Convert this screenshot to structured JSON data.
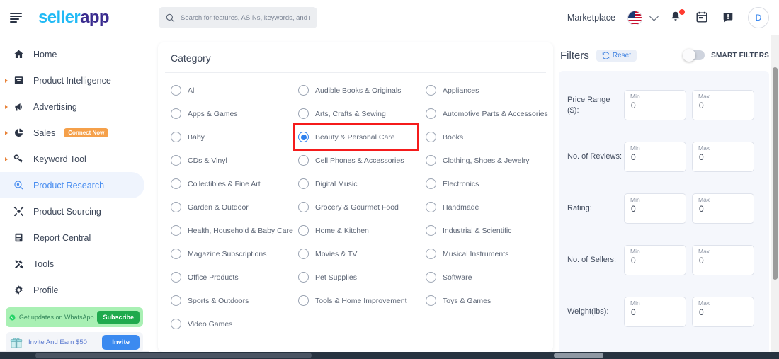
{
  "brand": {
    "name_part1": "seller",
    "name_part2": "app"
  },
  "topbar": {
    "menu_icon": "hamburger-icon",
    "search": {
      "placeholder": "Search for features, ASINs, keywords, and more",
      "value": ""
    },
    "marketplace_label": "Marketplace",
    "flag": "us-flag-icon",
    "notifications_icon": "bell-icon",
    "calendar_icon": "calendar-icon",
    "announcement_icon": "announcement-icon",
    "avatar_initial": "D"
  },
  "sidebar": {
    "items": [
      {
        "label": "Home",
        "icon": "home-icon",
        "expandable": false,
        "active": false
      },
      {
        "label": "Product Intelligence",
        "icon": "archive-icon",
        "expandable": true,
        "active": false
      },
      {
        "label": "Advertising",
        "icon": "megaphone-icon",
        "expandable": true,
        "active": false
      },
      {
        "label": "Sales",
        "icon": "pie-chart-icon",
        "expandable": true,
        "active": false,
        "badge": "Connect Now"
      },
      {
        "label": "Keyword Tool",
        "icon": "key-icon",
        "expandable": true,
        "active": false
      },
      {
        "label": "Product Research",
        "icon": "search-circle-icon",
        "expandable": false,
        "active": true
      },
      {
        "label": "Product Sourcing",
        "icon": "sourcing-icon",
        "expandable": false,
        "active": false
      },
      {
        "label": "Report Central",
        "icon": "report-icon",
        "expandable": false,
        "active": false
      },
      {
        "label": "Tools",
        "icon": "tools-icon",
        "expandable": false,
        "active": false
      },
      {
        "label": "Profile",
        "icon": "gear-icon",
        "expandable": false,
        "active": false
      }
    ],
    "promo_whatsapp": {
      "text": "Get updates on WhatsApp",
      "button": "Subscribe",
      "icon": "whatsapp-icon"
    },
    "promo_invite": {
      "text": "Invite And Earn $50",
      "button": "Invite",
      "icon": "gift-icon"
    }
  },
  "category": {
    "title": "Category",
    "selected": "Beauty & Personal Care",
    "columns": [
      [
        "All",
        "Apps & Games",
        "Baby",
        "CDs & Vinyl",
        "Collectibles & Fine Art",
        "Garden & Outdoor",
        "Health, Household & Baby Care",
        "Magazine Subscriptions",
        "Office Products",
        "Sports & Outdoors",
        "Video Games"
      ],
      [
        "Audible Books & Originals",
        "Arts, Crafts & Sewing",
        "Beauty & Personal Care",
        "Cell Phones & Accessories",
        "Digital Music",
        "Grocery & Gourmet Food",
        "Home & Kitchen",
        "Movies & TV",
        "Pet Supplies",
        "Tools & Home Improvement"
      ],
      [
        "Appliances",
        "Automotive Parts & Accessories",
        "Books",
        "Clothing, Shoes & Jewelry",
        "Electronics",
        "Handmade",
        "Industrial & Scientific",
        "Musical Instruments",
        "Software",
        "Toys & Games"
      ]
    ]
  },
  "filters": {
    "title": "Filters",
    "reset_label": "Reset",
    "reset_icon": "refresh-icon",
    "smart_filters_label": "SMART FILTERS",
    "smart_filters_on": false,
    "min_caption": "Min",
    "max_caption": "Max",
    "rows": [
      {
        "label": "Price Range ($):",
        "min": "0",
        "max": "0"
      },
      {
        "label": "No. of Reviews:",
        "min": "0",
        "max": "0"
      },
      {
        "label": "Rating:",
        "min": "0",
        "max": "0"
      },
      {
        "label": "No. of Sellers:",
        "min": "0",
        "max": "0"
      },
      {
        "label": "Weight(lbs):",
        "min": "0",
        "max": "0"
      }
    ]
  },
  "colors": {
    "accent_blue": "#2f80ed",
    "brand_cyan": "#21baf5",
    "brand_purple": "#3a2c8f",
    "highlight_red": "#f51b1b",
    "badge_orange": "#f5a04a",
    "whatsapp_green": "#1faa4d"
  }
}
